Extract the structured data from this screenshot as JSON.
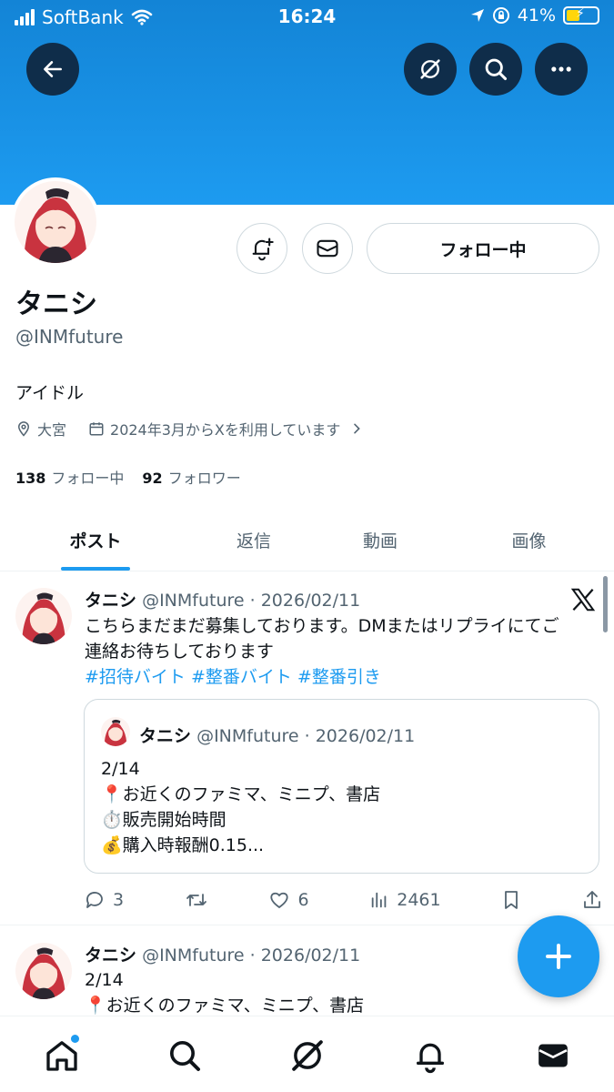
{
  "status_bar": {
    "carrier": "SoftBank",
    "time": "16:24",
    "battery": "41%"
  },
  "profile": {
    "display_name": "タニシ",
    "handle": "@INMfuture",
    "bio": "アイドル",
    "location": "大宮",
    "joined": "2024年3月からXを利用しています",
    "following_count": "138",
    "following_label": "フォロー中",
    "followers_count": "92",
    "followers_label": "フォロワー",
    "follow_button": "フォロー中"
  },
  "tabs": [
    {
      "label": "ポスト",
      "active": true
    },
    {
      "label": "返信",
      "active": false
    },
    {
      "label": "動画",
      "active": false
    },
    {
      "label": "画像",
      "active": false
    }
  ],
  "posts": [
    {
      "name": "タニシ",
      "handle": "@INMfuture",
      "separator": "·",
      "date": "2026/02/11",
      "text_line1": "こちらまだまだ募集しております。DMまたはリプライにてご",
      "text_line2": "連絡お待ちしております",
      "hashtags": "#招待バイト #整番バイト #整番引き",
      "quote": {
        "name": "タニシ",
        "handle": "@INMfuture",
        "date": "2026/02/11",
        "line1": "2/14",
        "line2": "📍お近くのファミマ、ミニプ、書店",
        "line3": "⏱️販売開始時間",
        "line4": "💰購入時報酬0.15..."
      },
      "replies": "3",
      "likes": "6",
      "views": "2461"
    },
    {
      "name": "タニシ",
      "handle": "@INMfuture",
      "separator": "·",
      "date": "2026/02/11",
      "line1": "2/14",
      "line2": "📍お近くのファミマ、ミニプ、書店"
    }
  ],
  "colors": {
    "accent": "#1d9bf0",
    "banner": "#1d9bf0",
    "secondary_text": "#536471"
  }
}
